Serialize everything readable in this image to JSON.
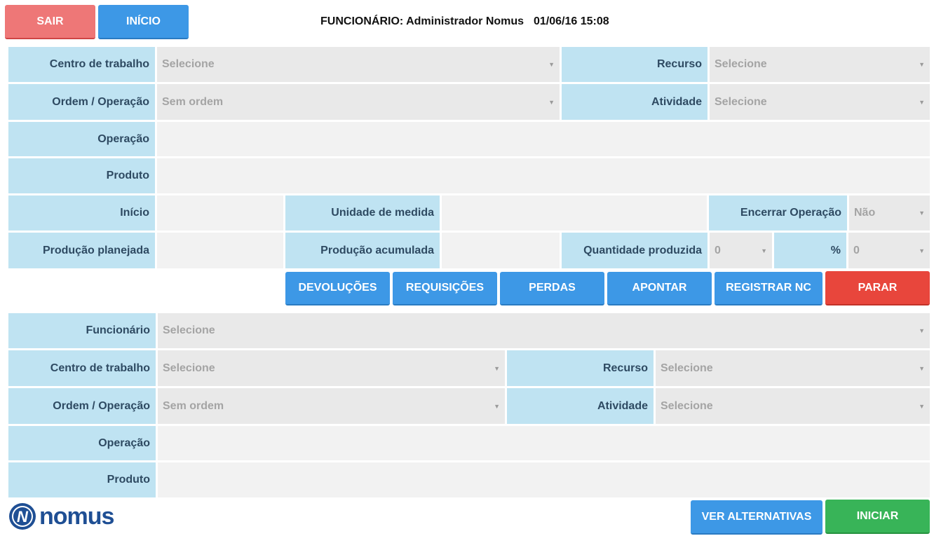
{
  "header": {
    "sair_label": "SAIR",
    "inicio_label": "INÍCIO",
    "funcionario_info": "FUNCIONÁRIO: Administrador Nomus",
    "datetime": "01/06/16 15:08"
  },
  "top_form": {
    "centro_label": "Centro de trabalho",
    "centro_value": "Selecione",
    "recurso_label": "Recurso",
    "recurso_value": "Selecione",
    "ordem_label": "Ordem / Operação",
    "ordem_value": "Sem ordem",
    "atividade_label": "Atividade",
    "atividade_value": "Selecione",
    "operacao_label": "Operação",
    "produto_label": "Produto",
    "inicio_label": "Início",
    "unidade_label": "Unidade de medida",
    "encerrar_label": "Encerrar Operação",
    "encerrar_value": "Não",
    "prod_planejada_label": "Produção planejada",
    "prod_acumulada_label": "Produção acumulada",
    "qtd_produzida_label": "Quantidade produzida",
    "qtd_produzida_value": "0",
    "percent_label": "%",
    "percent_value": "0"
  },
  "actions": {
    "devolucoes": "DEVOLUÇÕES",
    "requisicoes": "REQUISIÇÕES",
    "perdas": "PERDAS",
    "apontar": "APONTAR",
    "registrar_nc": "REGISTRAR NC",
    "parar": "PARAR"
  },
  "bottom_form": {
    "funcionario_label": "Funcionário",
    "funcionario_value": "Selecione",
    "centro_label": "Centro de trabalho",
    "centro_value": "Selecione",
    "recurso_label": "Recurso",
    "recurso_value": "Selecione",
    "ordem_label": "Ordem / Operação",
    "ordem_value": "Sem ordem",
    "atividade_label": "Atividade",
    "atividade_value": "Selecione",
    "operacao_label": "Operação",
    "produto_label": "Produto"
  },
  "footer": {
    "logo_text": "nomus",
    "logo_letter": "N",
    "ver_alternativas": "VER ALTERNATIVAS",
    "iniciar": "INICIAR"
  },
  "icons": {
    "dropdown": "chevron-down-icon"
  },
  "colors": {
    "label_bg": "#bfe3f2",
    "field_bg": "#f2f2f2",
    "select_bg": "#e9e9e9",
    "blue": "#3d98e6",
    "red": "#e8463c",
    "green": "#38b458",
    "logo": "#1f4f94"
  }
}
